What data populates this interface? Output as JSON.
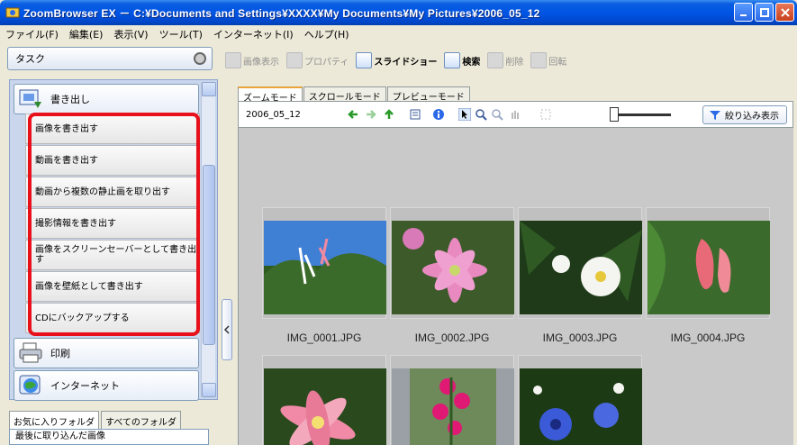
{
  "window": {
    "title": "ZoomBrowser EX  －  C:¥Documents and Settings¥XXXX¥My Documents¥My Pictures¥2006_05_12"
  },
  "menu": [
    "ファイル(F)",
    "編集(E)",
    "表示(V)",
    "ツール(T)",
    "インターネット(I)",
    "ヘルプ(H)"
  ],
  "task_label": "タスク",
  "categories": {
    "export": "書き出し",
    "print": "印刷",
    "internet": "インターネット"
  },
  "export_items": [
    "画像を書き出す",
    "動画を書き出す",
    "動画から複数の静止画を取り出す",
    "撮影情報を書き出す",
    "画像をスクリーンセーバーとして書き出す",
    "画像を壁紙として書き出す",
    "CDにバックアップする"
  ],
  "fav_tabs": [
    "お気に入りフォルダ",
    "すべてのフォルダ"
  ],
  "fav_first": "最後に取り込んだ画像",
  "toolbar": [
    "画像表示",
    "プロパティ",
    "スライドショー",
    "検索",
    "削除",
    "回転"
  ],
  "mode_tabs": [
    "ズームモード",
    "スクロールモード",
    "プレビューモード"
  ],
  "folder": "2006_05_12",
  "filter_label": "絞り込み表示",
  "photos": [
    "IMG_0001.JPG",
    "IMG_0002.JPG",
    "IMG_0003.JPG",
    "IMG_0004.JPG"
  ]
}
